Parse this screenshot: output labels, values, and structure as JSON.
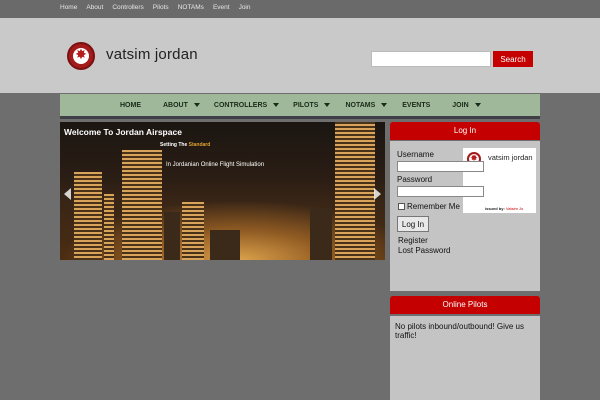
{
  "topbar": {
    "links": [
      "Home",
      "About",
      "Controllers",
      "Pilots",
      "NOTAMs",
      "Event",
      "Join"
    ]
  },
  "header": {
    "logo_text": "vatsim jordan",
    "logo_icon": "star-icon"
  },
  "search": {
    "placeholder": "",
    "button_label": "Search"
  },
  "nav": {
    "items": [
      {
        "label": "HOME",
        "has_dropdown": false
      },
      {
        "label": "ABOUT",
        "has_dropdown": true
      },
      {
        "label": "CONTROLLERS",
        "has_dropdown": true
      },
      {
        "label": "PILOTS",
        "has_dropdown": true
      },
      {
        "label": "NOTAMS",
        "has_dropdown": true
      },
      {
        "label": "EVENTS",
        "has_dropdown": false
      },
      {
        "label": "JOIN",
        "has_dropdown": true
      }
    ]
  },
  "slider": {
    "title": "Welcome To Jordan Airspace",
    "sub1_pre": "Setting The ",
    "sub1_highlight": "Standard",
    "sub2": "In Jordanian Online Flight Simulation"
  },
  "login": {
    "title": "Log In",
    "username_label": "Username",
    "password_label": "Password",
    "remember_label": "Remember Me",
    "button_label": "Log In",
    "register_link": "Register",
    "lost_password_link": "Lost Password",
    "badge_name": "vatsim jordan",
    "badge_issued_prefix": "issued by: ",
    "badge_issued_by": "Vatsim Jo"
  },
  "pilots": {
    "title": "Online Pilots",
    "message": "No pilots inbound/outbound! Give us traffic!"
  },
  "colors": {
    "accent": "#c40000",
    "nav_bg": "#9fb89a",
    "header_bg": "#c9c9c9",
    "page_bg": "#6e6e6e"
  }
}
